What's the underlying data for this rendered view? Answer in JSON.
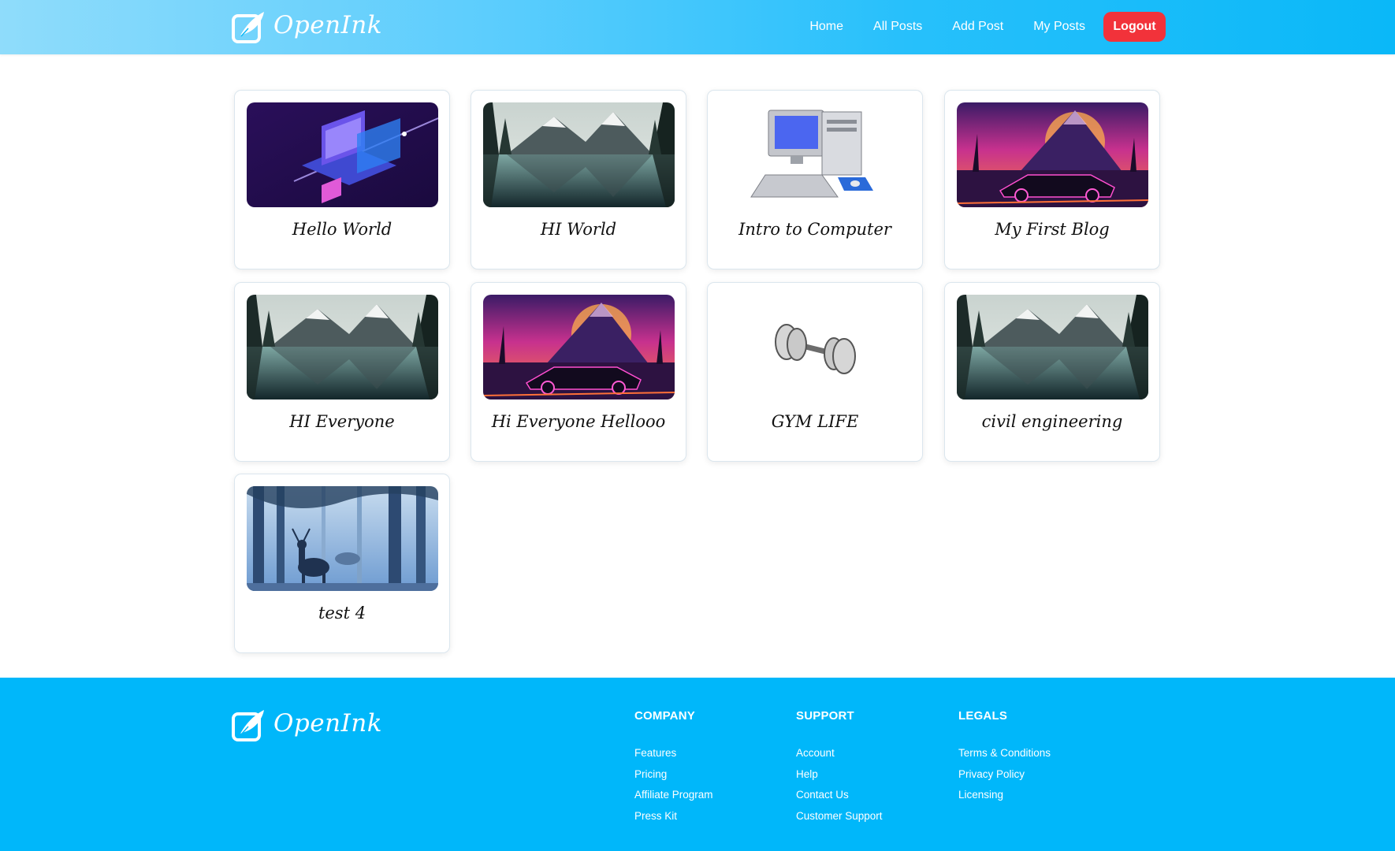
{
  "brand": {
    "name": "OpenInk"
  },
  "nav": {
    "links": [
      "Home",
      "All Posts",
      "Add Post",
      "My Posts"
    ],
    "logout_label": "Logout",
    "logout_color": "#f2323a"
  },
  "posts": [
    {
      "title": "Hello World",
      "image": "isometric-laptop"
    },
    {
      "title": "HI World",
      "image": "mountain-lake"
    },
    {
      "title": "Intro to Computer",
      "image": "desktop-computer"
    },
    {
      "title": "My First Blog",
      "image": "synthwave-car"
    },
    {
      "title": "HI Everyone",
      "image": "mountain-lake"
    },
    {
      "title": "Hi Everyone Hellooo",
      "image": "synthwave-car"
    },
    {
      "title": "GYM LIFE",
      "image": "dumbbell"
    },
    {
      "title": "civil engineering",
      "image": "mountain-lake"
    },
    {
      "title": "test 4",
      "image": "forest-deer"
    }
  ],
  "footer": {
    "company": {
      "heading": "COMPANY",
      "links": [
        "Features",
        "Pricing",
        "Affiliate Program",
        "Press Kit"
      ]
    },
    "support": {
      "heading": "SUPPORT",
      "links": [
        "Account",
        "Help",
        "Contact Us",
        "Customer Support"
      ]
    },
    "legals": {
      "heading": "LEGALS",
      "links": [
        "Terms & Conditions",
        "Privacy Policy",
        "Licensing"
      ]
    }
  },
  "colors": {
    "nav_gradient_end": "#0ab8f8",
    "footer_bg": "#00b7fa"
  }
}
